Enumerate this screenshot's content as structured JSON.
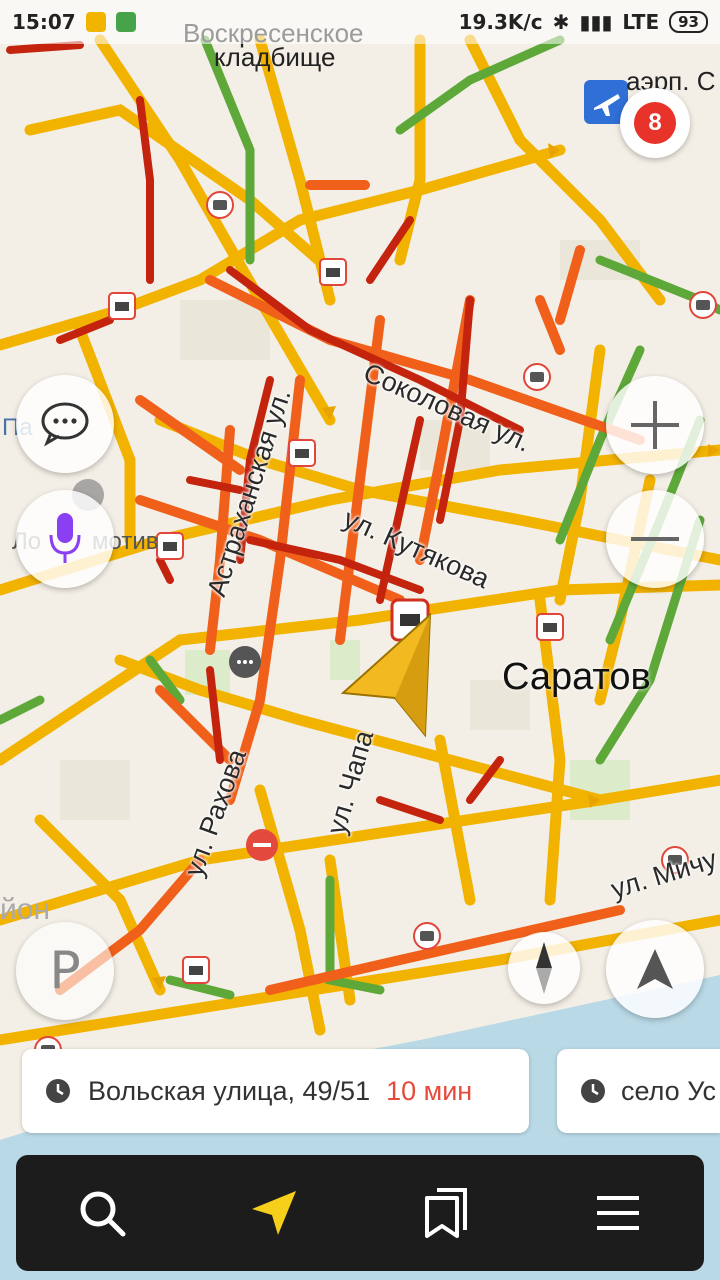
{
  "status_bar": {
    "time": "15:07",
    "net_speed": "19.3K/c",
    "network": "LTE",
    "battery": "93"
  },
  "map": {
    "labels": {
      "cemetery_line1": "Воскресенское",
      "cemetery_line2": "кладбище",
      "airport": "аэрп. С",
      "city": "Саратов",
      "left_partial_1": "Па",
      "left_partial_2": "Ло",
      "left_partial_3": "мотив",
      "left_partial_4": "йон"
    },
    "streets": {
      "sokolovaya": "Соколовая ул.",
      "astrakhanskaya": "Астраханская ул.",
      "kutyakova": "ул. Кутякова",
      "rakhova": "ул. Рахова",
      "chapaeva": "ул. Чапа",
      "michurina": "ул. Мичу"
    },
    "colors": {
      "jam_heavy": "#c4240e",
      "jam_medium": "#f0601a",
      "jam_light": "#f2b200",
      "free": "#5ea83a",
      "water": "#b9d9e6"
    }
  },
  "controls": {
    "events_count": "8"
  },
  "route_cards": [
    {
      "address": "Вольская улица, 49/51",
      "eta": "10 мин"
    },
    {
      "address": "село Ус",
      "eta": ""
    }
  ],
  "bottom_nav": [
    "search-icon",
    "navigator-icon",
    "bookmarks-icon",
    "menu-icon"
  ]
}
